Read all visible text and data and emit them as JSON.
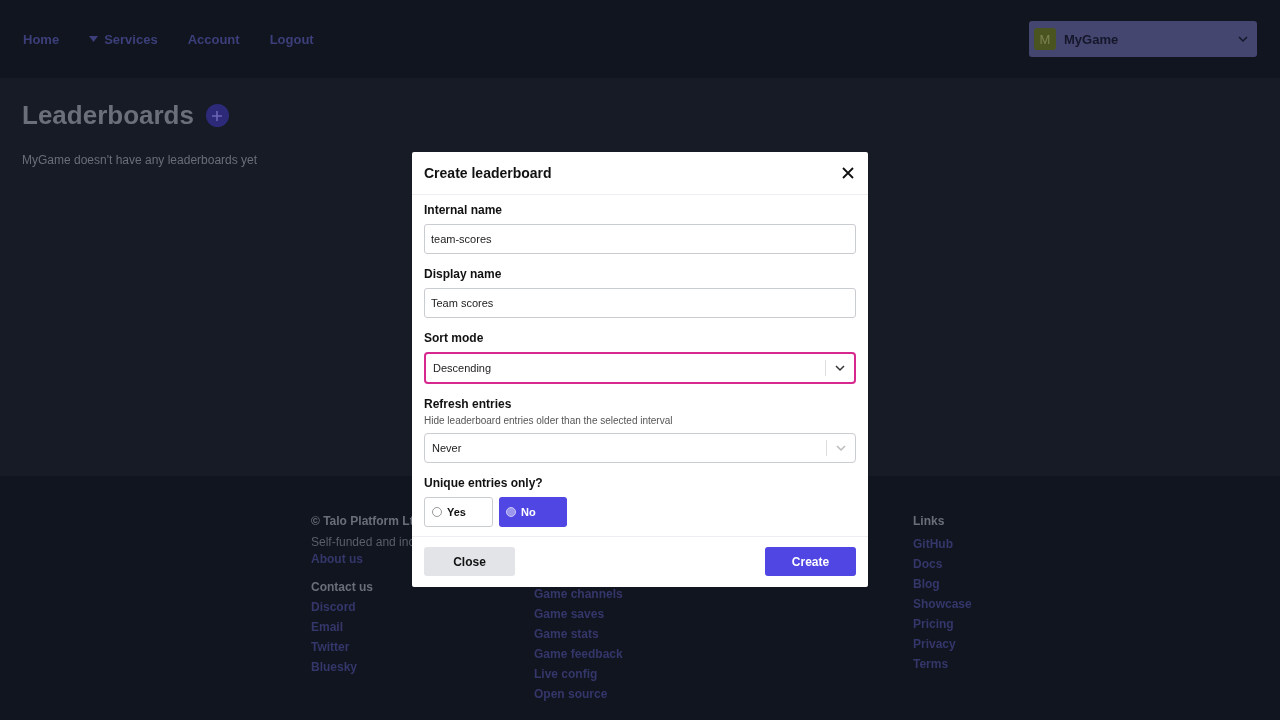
{
  "nav": {
    "links": [
      {
        "label": "Home",
        "kind": "link"
      },
      {
        "label": "Services",
        "kind": "dropdown"
      },
      {
        "label": "Account",
        "kind": "link"
      },
      {
        "label": "Logout",
        "kind": "link"
      }
    ],
    "game_switcher": {
      "initial": "M",
      "name": "MyGame"
    }
  },
  "page": {
    "title": "Leaderboards",
    "empty_message": "MyGame doesn't have any leaderboards yet"
  },
  "footer": {
    "column_1": {
      "lines": [
        "© Talo Platform Lt",
        "Self-funded and inc"
      ],
      "link": "About us",
      "heading": "Contact us",
      "links": [
        "Discord",
        "Email",
        "Twitter",
        "Bluesky"
      ]
    },
    "column_2": {
      "links": [
        "Game channels",
        "Game saves",
        "Game stats",
        "Game feedback",
        "Live config",
        "Open source"
      ]
    },
    "column_3": {
      "heading": "Links",
      "links": [
        "GitHub",
        "Docs",
        "Blog",
        "Showcase",
        "Pricing",
        "Privacy",
        "Terms"
      ]
    }
  },
  "modal": {
    "title": "Create leaderboard",
    "fields": [
      {
        "kind": "text",
        "label": "Internal name",
        "value": "team-scores"
      },
      {
        "kind": "text",
        "label": "Display name",
        "value": "Team scores"
      },
      {
        "kind": "select",
        "label": "Sort mode",
        "value": "Descending",
        "focused": true
      },
      {
        "kind": "select",
        "label": "Refresh entries",
        "hint": "Hide leaderboard entries older than the selected interval",
        "value": "Never",
        "focused": false
      },
      {
        "kind": "radio",
        "label": "Unique entries only?",
        "options": [
          {
            "label": "Yes",
            "selected": false
          },
          {
            "label": "No",
            "selected": true
          }
        ]
      }
    ],
    "buttons": [
      {
        "label": "Close",
        "kind": "secondary"
      },
      {
        "label": "Create",
        "kind": "primary"
      }
    ]
  }
}
